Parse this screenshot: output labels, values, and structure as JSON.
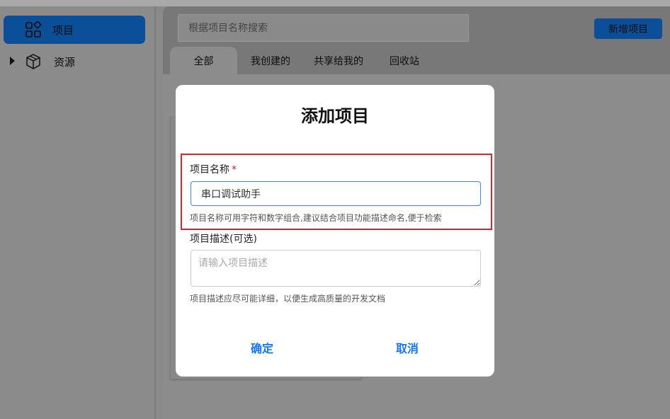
{
  "sidebar": {
    "items": [
      {
        "label": "项目",
        "icon": "grid-apps-icon",
        "active": true
      },
      {
        "label": "资源",
        "icon": "cube-box-icon",
        "active": false
      }
    ]
  },
  "header": {
    "search_placeholder": "根据项目名称搜索",
    "new_button": "新增项目",
    "tabs": [
      {
        "label": "全部",
        "active": true
      },
      {
        "label": "我创建的"
      },
      {
        "label": "共享给我的"
      },
      {
        "label": "回收站"
      }
    ]
  },
  "modal": {
    "title": "添加项目",
    "name_label": "项目名称",
    "required_mark": "*",
    "name_value": "串口调试助手",
    "name_hint": "项目名称可用字符和数字组合,建议结合项目功能描述命名,便于检索",
    "desc_label": "项目描述(可选)",
    "desc_placeholder": "请输入项目描述",
    "desc_hint": "项目描述应尽可能详细，以便生成高质量的开发文档",
    "confirm": "确定",
    "cancel": "取消"
  },
  "colors": {
    "accent": "#1677e8",
    "highlight": "#d9262c",
    "overlay": "#8a8a8a"
  }
}
